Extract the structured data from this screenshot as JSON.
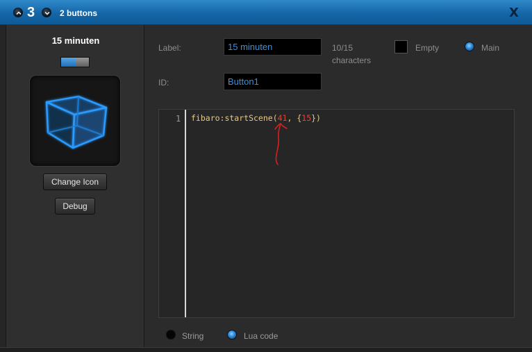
{
  "titlebar": {
    "count": "3",
    "title": "2 buttons",
    "close": "X"
  },
  "left": {
    "button_name": "15 minuten",
    "toggle_state": "on",
    "change_icon_label": "Change Icon",
    "debug_label": "Debug",
    "icon": "3d-cube-icon"
  },
  "form": {
    "label_caption": "Label:",
    "label_value": "15 minuten",
    "counter_line1": "10/15",
    "counter_line2": "characters",
    "empty_label": "Empty",
    "main_label": "Main",
    "main_selected": true,
    "id_caption": "ID:",
    "id_value": "Button1"
  },
  "editor": {
    "line_number": "1",
    "code_prefix": "fibaro:startScene(",
    "code_num1": "41",
    "code_mid": ", {",
    "code_num2": "15",
    "code_suffix": "})"
  },
  "mode": {
    "string_label": "String",
    "lua_label": "Lua code",
    "selected": "Lua code"
  },
  "colors": {
    "accent": "#1e72b8",
    "code_text": "#e7c98a",
    "code_number": "#d9483b",
    "field_text": "#3d8fe0"
  }
}
